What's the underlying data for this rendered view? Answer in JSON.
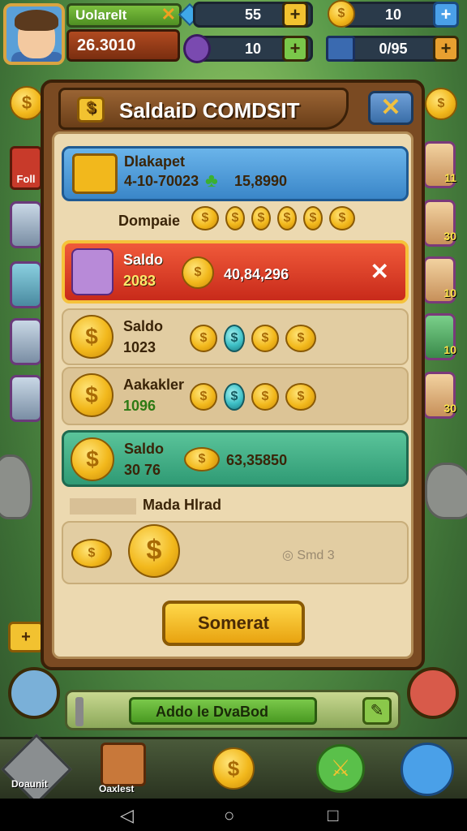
{
  "hud": {
    "player_name": "Uolarelt",
    "score": "26.3010",
    "resources": [
      {
        "icon": "gem-icon",
        "value": "55"
      },
      {
        "icon": "gold-coin-icon",
        "value": "10"
      },
      {
        "icon": "purple-bag-icon",
        "value": "10"
      },
      {
        "icon": "chest-icon",
        "value": "0/95"
      }
    ]
  },
  "side": {
    "left_top_label": "Foll",
    "left_bottom_label": "",
    "right_values": [
      "11",
      "30",
      "10",
      "10",
      "30"
    ],
    "left_side_button": "+"
  },
  "panel": {
    "title": "SaldaiD COMDSIT",
    "close_label": "✕",
    "blue_row": {
      "label": "Dlakapet",
      "value_a": "4-10-70023",
      "value_b": "15,8990"
    },
    "deposit_label": "Dompaie",
    "red_row": {
      "label": "Saldo",
      "amount": "2083",
      "value": "40,84,296",
      "close": "✕"
    },
    "row3": {
      "label": "Saldo",
      "amount": "1023"
    },
    "row4": {
      "label": "Aakakler",
      "amount": "1096"
    },
    "teal_row": {
      "label": "Saldo",
      "amount": "30 76",
      "value": "63,35850"
    },
    "section_label": "Mada Hlrad",
    "small_label": "Smd",
    "small_value": "3",
    "main_button": "Somerat"
  },
  "bottom": {
    "add_label": "Addo le DvaBod",
    "nav_left_label": "Doaunit",
    "nav_char_label": "Oaxlest"
  }
}
